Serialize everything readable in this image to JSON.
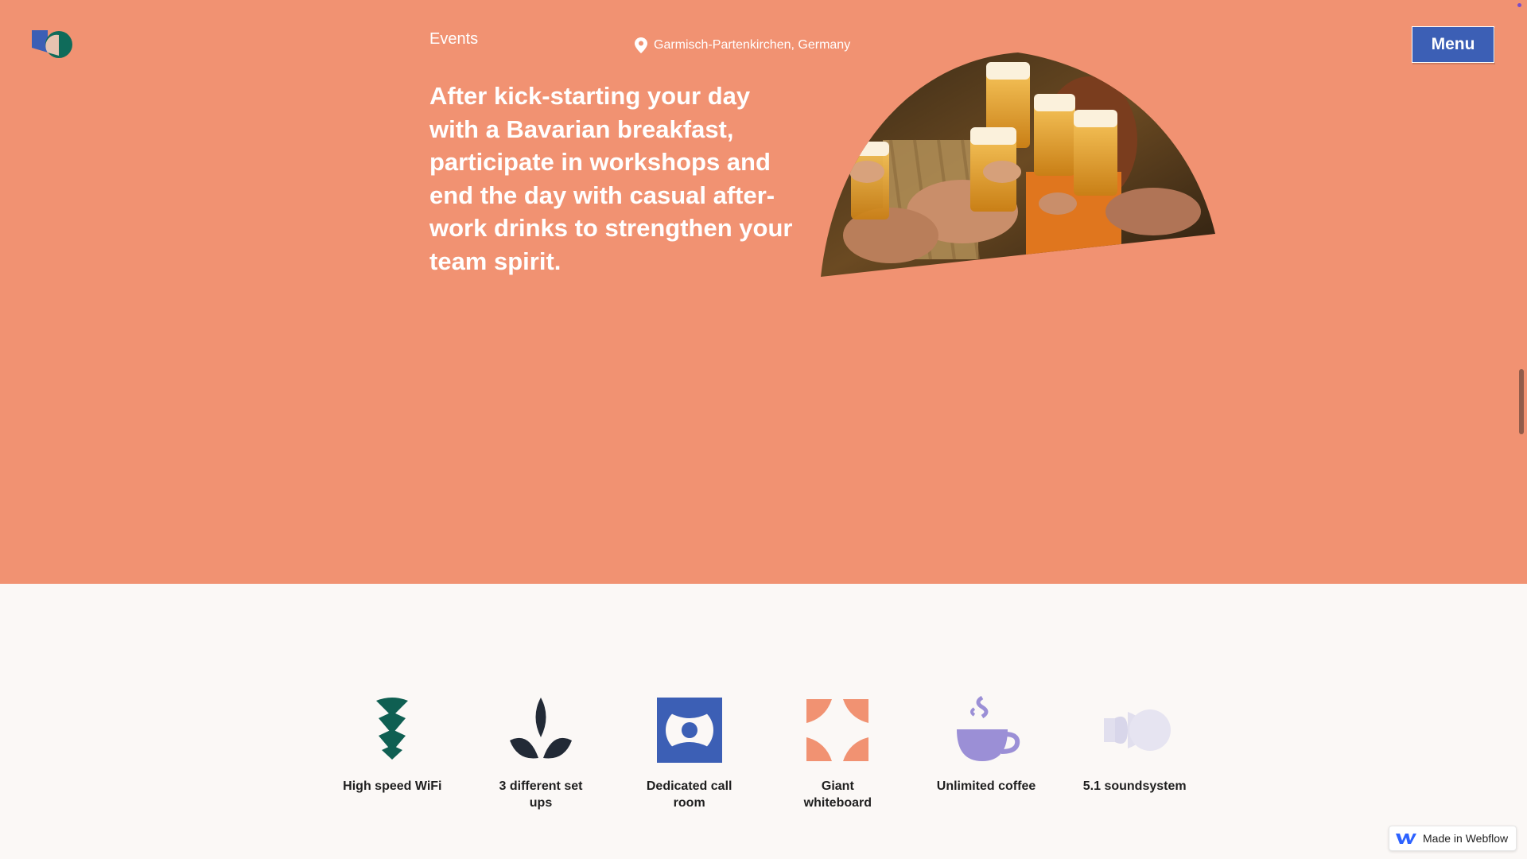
{
  "header": {
    "nav_events": "Events",
    "location": "Garmisch-Partenkirchen, Germany",
    "menu_label": "Menu"
  },
  "hero": {
    "headline": "After kick-starting your day with a Bavarian breakfast, participate in workshops and end the day with casual after-work drinks to strengthen your team spirit."
  },
  "amenities": [
    {
      "icon": "wifi-chevrons-icon",
      "label": "High speed WiFi"
    },
    {
      "icon": "sprout-icon",
      "label": "3 different set ups"
    },
    {
      "icon": "call-room-icon",
      "label": "Dedicated call room"
    },
    {
      "icon": "whiteboard-corners-icon",
      "label": "Giant whiteboard"
    },
    {
      "icon": "coffee-cup-icon",
      "label": "Unlimited coffee"
    },
    {
      "icon": "speaker-waves-icon",
      "label": "5.1 soundsystem"
    }
  ],
  "badge": {
    "label": "Made in Webflow"
  },
  "colors": {
    "hero_background": "#f19272",
    "menu_button": "#3c5fb5",
    "page_background": "#fbf8f6"
  }
}
